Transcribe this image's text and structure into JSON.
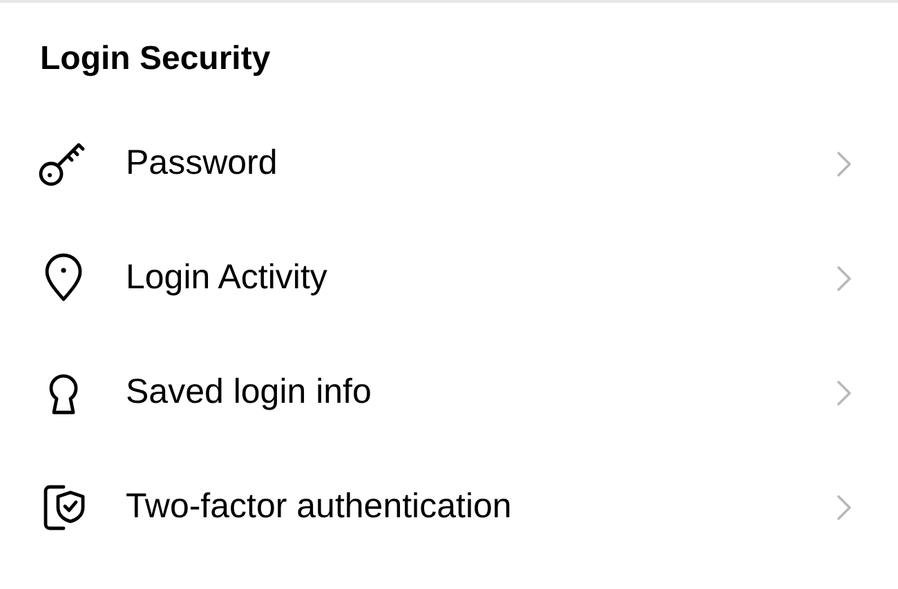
{
  "section": {
    "title": "Login Security"
  },
  "items": [
    {
      "kind": "key",
      "label": "Password"
    },
    {
      "kind": "pin",
      "label": "Login Activity"
    },
    {
      "kind": "keyhole",
      "label": "Saved login info"
    },
    {
      "kind": "shield",
      "label": "Two-factor authentication"
    }
  ]
}
